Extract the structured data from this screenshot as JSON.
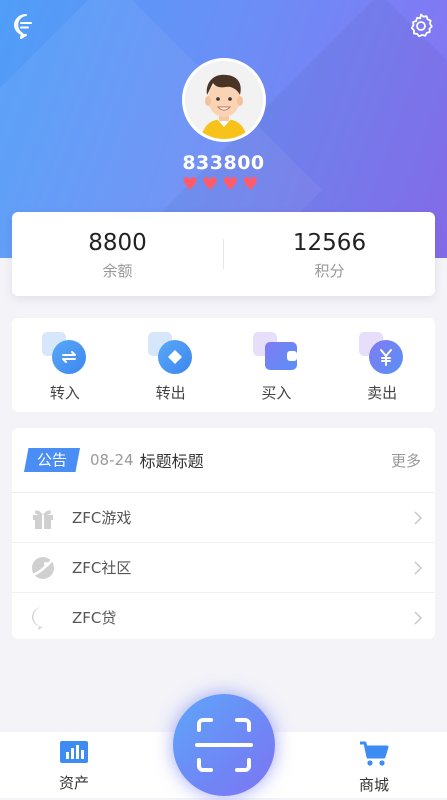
{
  "header": {
    "message_icon": "chat-bubble-icon",
    "settings_icon": "gear-icon",
    "username": "833800",
    "heart_count": 4,
    "heart_glyph": "♥"
  },
  "stats": [
    {
      "value": "8800",
      "label": "余额"
    },
    {
      "value": "12566",
      "label": "积分"
    }
  ],
  "actions": [
    {
      "label": "转入",
      "icon": "transfer-in-icon"
    },
    {
      "label": "转出",
      "icon": "transfer-out-icon"
    },
    {
      "label": "买入",
      "icon": "wallet-icon"
    },
    {
      "label": "卖出",
      "icon": "yen-icon"
    }
  ],
  "notice": {
    "badge": "公告",
    "date": "08-24",
    "title": "标题标题",
    "more": "更多"
  },
  "menu": [
    {
      "label": "ZFC游戏",
      "icon": "gift-icon"
    },
    {
      "label": "ZFC社区",
      "icon": "planet-icon"
    },
    {
      "label": "ZFC贷",
      "icon": "chat-dots-icon"
    }
  ],
  "tabbar": {
    "left_label": "资产",
    "right_label": "商城",
    "center": "scan-icon"
  },
  "colors": {
    "accent": "#4a8ef5",
    "heart": "#ff5b6a",
    "gradient_start": "#4f9ef8",
    "gradient_end": "#8a6ff2"
  }
}
